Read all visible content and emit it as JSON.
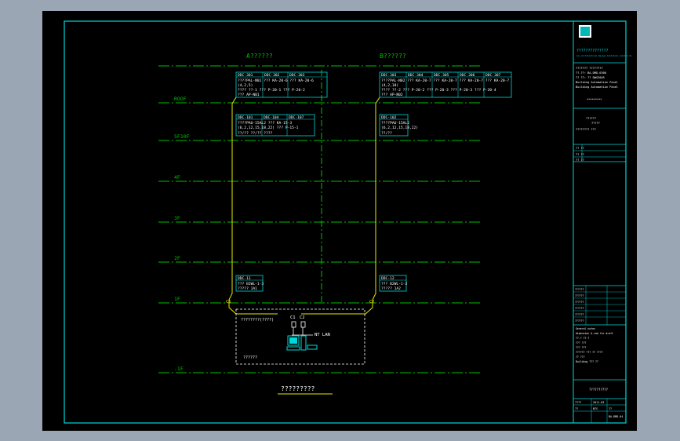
{
  "colors": {
    "frame": "#00d8d8",
    "floor_line": "#00c000",
    "trunk": "#e8e800",
    "riser_dash": "#00c000",
    "floor_label": "#00c000",
    "text": "#ffffff",
    "accent_label": "#00c000"
  },
  "headers": {
    "a": "A??????",
    "b": "B??????"
  },
  "floors": [
    "ROOF",
    "5F10F",
    "4F",
    "3F",
    "2F",
    "1F",
    "-1F"
  ],
  "panels": {
    "roof_a": {
      "cells": [
        "DDC-301",
        "DDC-302",
        "DDC-303"
      ],
      "rows": [
        "????PAL-N01 ??? KA-20-6 ??? KA-20-6",
        "(4,2,5)",
        "???? ??-1 ??? P-20-1 ??? P-20-2",
        "??? AP-N01"
      ]
    },
    "roof_b": {
      "cells": [
        "DDC-303",
        "DDC-304",
        "DDC-305",
        "DDC-306",
        "DDC-307"
      ],
      "rows": [
        "????PAL-N02 ??? KA-20-7 ??? KA-20-7 ??? KA-20-7 ??? KA-20-7",
        "(4,2,10)",
        "???? ??-2 ??? P-20-2 ??? P-20-3 ??? P-20-3 ??? P-20-4",
        "??? AP-N02"
      ]
    },
    "f5_a": {
      "cells": [
        "DDC-101",
        "DDC-104",
        "DDC-107"
      ],
      "rows": [
        "????PAU-15AL2 ??? KA-15-3",
        "(6,2,12,15,18,22) ??? P-15-1",
        "??/?? ??/?? ????"
      ]
    },
    "f5_b": {
      "cells": [
        "DDC-102"
      ],
      "rows": [
        "????PAU-15AL2",
        "(6,2,12,15,18,22)",
        "??/??"
      ]
    },
    "f1_a": {
      "cell": "DDC-11",
      "rows": [
        "??? B1WL-1-3",
        "????? 1A1"
      ]
    },
    "f1_b": {
      "cell": "DDC-12",
      "rows": [
        "??? B2WL-1-3",
        "????? 1A2"
      ]
    }
  },
  "control_room": {
    "title": "????????(????)",
    "bus_1": "C1",
    "bus_2": "C2",
    "network": "NT LAN",
    "footer": "??????"
  },
  "bus_tags": {
    "left": "C1",
    "right": "C2"
  },
  "drawing_title": "?????????",
  "title_block": {
    "company": "??????????????",
    "company_en": "xxx Architectural Design Institute Limited Co.",
    "meta_lines": [
      "??????? ????????",
      "??.??: BA-DMD-0300",
      "?? ??: ?? DWG3005",
      "Building Automation Panel",
      "Building Automation Panel"
    ],
    "project_no": "*********",
    "project_lines": [
      "??????",
      "?????"
    ],
    "sub_label": "???????? ???",
    "roles": [
      "?? ??",
      "?? ??",
      "?? ?? ?",
      "?? ?? ??"
    ],
    "stage": "?? ??",
    "sign_rows": [
      "??????",
      "??????",
      "??????",
      "??????",
      "??????",
      "??????"
    ],
    "stamp_lines": [
      "General notes",
      "dimension & cad for draft",
      "??.? ??.?",
      "??? ???",
      "??? ???",
      "?????? ??? ?? ????",
      "?? ???",
      "Building ??? ??"
    ],
    "sheet_title": "??????????",
    "drawing_no_label": "????",
    "drawing_no": "2011-03",
    "scale_label": "??",
    "scale": "NTS",
    "page": "BA-DMD-04",
    "sheet_no": "??"
  }
}
